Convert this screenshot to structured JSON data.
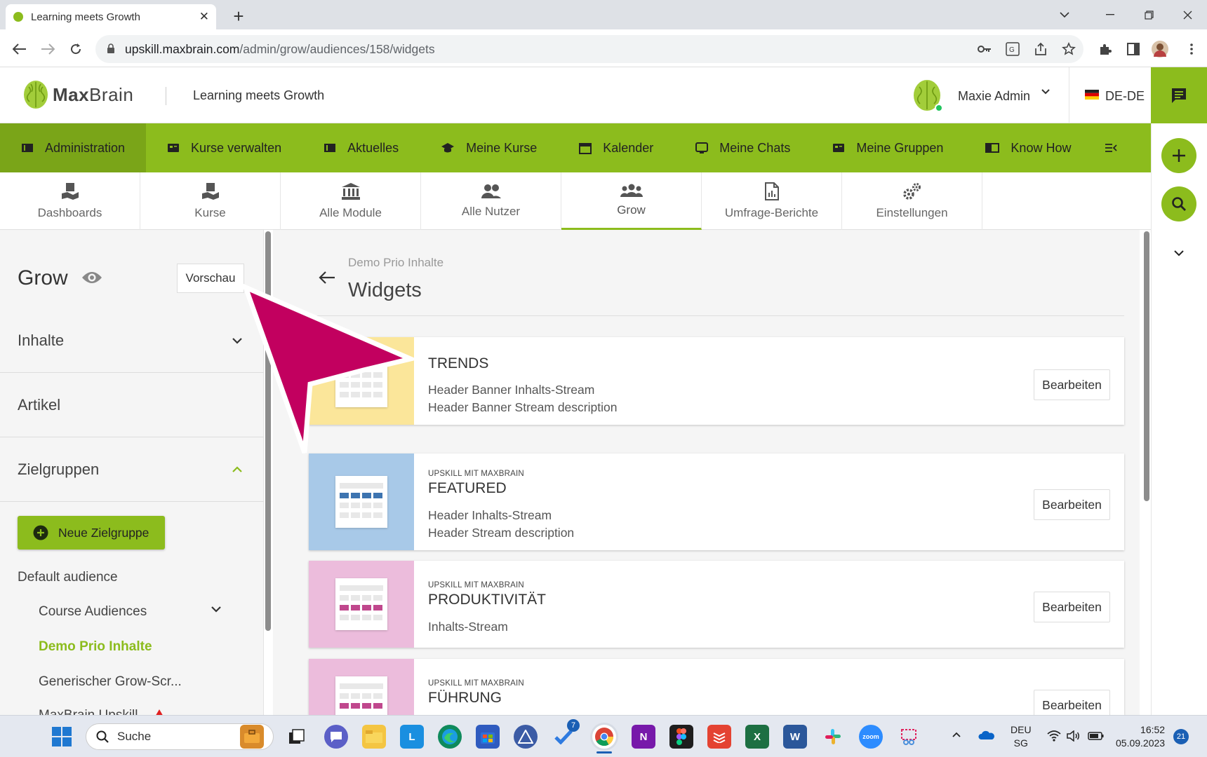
{
  "browser": {
    "tab_title": "Learning meets Growth",
    "url_host": "upskill.maxbrain.com",
    "url_path": "/admin/grow/audiences/158/widgets"
  },
  "header": {
    "logo_bold": "Max",
    "logo_light": "Brain",
    "site_name": "Learning meets Growth",
    "user_name": "Maxie Admin",
    "language": "DE-DE"
  },
  "main_nav": [
    {
      "label": "Administration",
      "icon": "admin-icon"
    },
    {
      "label": "Kurse verwalten",
      "icon": "courses-manage-icon"
    },
    {
      "label": "Aktuelles",
      "icon": "news-icon"
    },
    {
      "label": "Meine Kurse",
      "icon": "graduation-cap-icon"
    },
    {
      "label": "Kalender",
      "icon": "calendar-icon"
    },
    {
      "label": "Meine Chats",
      "icon": "chat-icon"
    },
    {
      "label": "Meine Gruppen",
      "icon": "groups-icon"
    },
    {
      "label": "Know How",
      "icon": "book-icon"
    }
  ],
  "sub_tabs": [
    {
      "label": "Dashboards"
    },
    {
      "label": "Kurse"
    },
    {
      "label": "Alle Module"
    },
    {
      "label": "Alle Nutzer"
    },
    {
      "label": "Grow"
    },
    {
      "label": "Umfrage-Berichte"
    },
    {
      "label": "Einstellungen"
    }
  ],
  "left_panel": {
    "title": "Grow",
    "preview_button": "Vorschau",
    "sections": [
      "Inhalte",
      "Artikel",
      "Zielgruppen"
    ],
    "new_target_button": "Neue Zielgruppe",
    "audiences": {
      "default": "Default audience",
      "course": "Course Audiences",
      "demo": "Demo Prio Inhalte",
      "generic": "Generischer Grow-Scr...",
      "upskill": "MaxBrain Upskill"
    }
  },
  "content": {
    "breadcrumb": "Demo Prio Inhalte",
    "title": "Widgets",
    "cards": [
      {
        "kicker": "",
        "title": "TRENDS",
        "line1": "Header Banner Inhalts-Stream",
        "line2": "Header Banner Stream description",
        "button": "Bearbeiten",
        "color": "#fbe69a",
        "accent": "#f0b23c"
      },
      {
        "kicker": "UPSKILL MIT MAXBRAIN",
        "title": "FEATURED",
        "line1": "Header Inhalts-Stream",
        "line2": "Header Stream description",
        "button": "Bearbeiten",
        "color": "#a8c9e8",
        "accent": "#3d74b0"
      },
      {
        "kicker": "UPSKILL MIT MAXBRAIN",
        "title": "PRODUKTIVITÄT",
        "line1": "Inhalts-Stream",
        "line2": "",
        "button": "Bearbeiten",
        "color": "#ecbcdc",
        "accent": "#c0478d"
      },
      {
        "kicker": "UPSKILL MIT MAXBRAIN",
        "title": "FÜHRUNG",
        "line1": "",
        "line2": "",
        "button": "Bearbeiten",
        "color": "#ecbcdc",
        "accent": "#c0478d"
      }
    ]
  },
  "taskbar": {
    "search": "Suche",
    "lang_top": "DEU",
    "lang_bottom": "SG",
    "time": "16:52",
    "date": "05.09.2023",
    "notifications": "21",
    "badge": "7"
  },
  "colors": {
    "brand_green": "#8cbc1d",
    "annotation": "#c2005f"
  }
}
